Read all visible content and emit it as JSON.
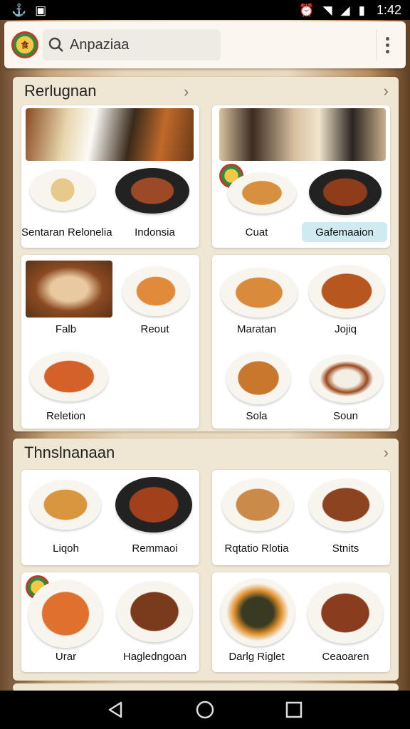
{
  "status_bar": {
    "time": "1:42"
  },
  "search": {
    "query": "Anpaziaa"
  },
  "sections": [
    {
      "title": "Rerlugnan",
      "cards": [
        {
          "labels": [
            "Sentaran Relonelia",
            "Indonsia"
          ]
        },
        {
          "labels": [
            "Cuat",
            "Gafemaaion"
          ]
        },
        {
          "labels": [
            "Falb",
            "Reout",
            "Reletion"
          ]
        },
        {
          "labels": [
            "Maratan",
            "Jojiq",
            "Sola",
            "Soun"
          ]
        }
      ]
    },
    {
      "title": "Thnslnanaan",
      "cards": [
        {
          "labels": [
            "Liqoh",
            "Remmaoi"
          ]
        },
        {
          "labels": [
            "Rqtatio Rlotia",
            "Stnits"
          ]
        },
        {
          "labels": [
            "Urar",
            "Hagledngoan"
          ]
        },
        {
          "labels": [
            "Darlg Riglet",
            "Ceaoaren"
          ]
        }
      ]
    }
  ],
  "colors": {
    "accent_pill": "#cfeaf1",
    "section_bg": "#efe6d4"
  },
  "icons": [
    "app-logo-icon",
    "search-icon",
    "more-vert-icon",
    "back-icon",
    "home-icon",
    "recents-icon"
  ]
}
